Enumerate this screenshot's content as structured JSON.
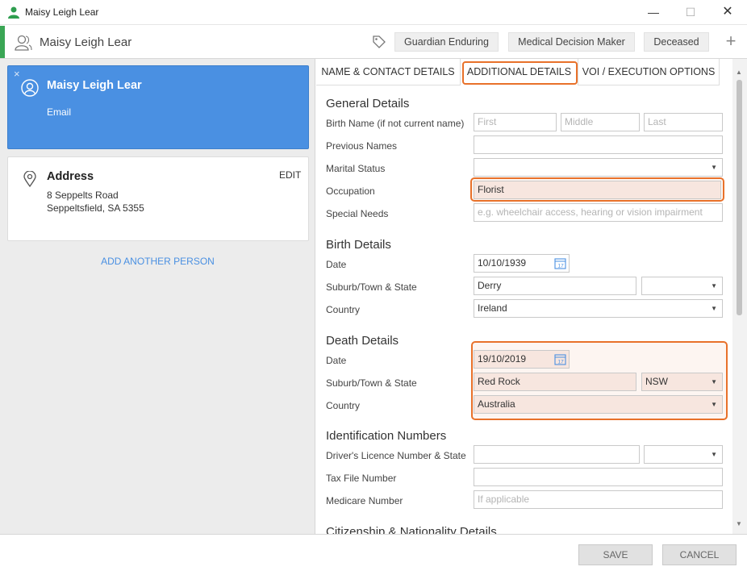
{
  "window": {
    "title": "Maisy Leigh Lear",
    "minimize": "—",
    "maximize": "☐",
    "close": "✕"
  },
  "header": {
    "name": "Maisy Leigh Lear",
    "tags": [
      "Guardian Enduring",
      "Medical Decision Maker",
      "Deceased"
    ],
    "add": "+"
  },
  "sidebar": {
    "person": {
      "name": "Maisy Leigh Lear",
      "email_label": "Email",
      "remove": "×"
    },
    "address": {
      "title": "Address",
      "edit": "EDIT",
      "line1": "8 Seppelts Road",
      "line2": "Seppeltsfield, SA 5355"
    },
    "add_person": "ADD ANOTHER PERSON"
  },
  "tabs": [
    "NAME & CONTACT DETAILS",
    "ADDITIONAL DETAILS",
    "VOI / EXECUTION OPTIONS"
  ],
  "general": {
    "heading": "General Details",
    "birth_name_label": "Birth Name (if not current name)",
    "first_ph": "First",
    "middle_ph": "Middle",
    "last_ph": "Last",
    "previous_names_label": "Previous Names",
    "marital_label": "Marital Status",
    "occupation_label": "Occupation",
    "occupation": "Florist",
    "special_label": "Special Needs",
    "special_ph": "e.g. wheelchair access, hearing or vision impairment"
  },
  "birth": {
    "heading": "Birth Details",
    "date_label": "Date",
    "date": "10/10/1939",
    "suburb_label": "Suburb/Town & State",
    "suburb": "Derry",
    "state": "",
    "country_label": "Country",
    "country": "Ireland"
  },
  "death": {
    "heading": "Death Details",
    "date_label": "Date",
    "date": "19/10/2019",
    "suburb_label": "Suburb/Town & State",
    "suburb": "Red Rock",
    "state": "NSW",
    "country_label": "Country",
    "country": "Australia"
  },
  "identification": {
    "heading": "Identification Numbers",
    "licence_label": "Driver's Licence Number & State",
    "tfn_label": "Tax File Number",
    "medicare_label": "Medicare Number",
    "medicare_ph": "If applicable"
  },
  "citizenship": {
    "heading": "Citizenship & Nationality Details"
  },
  "footer": {
    "save": "SAVE",
    "cancel": "CANCEL"
  },
  "colors": {
    "accent_green": "#3aa655",
    "card_blue": "#4a90e2",
    "highlight": "#e8712a"
  }
}
